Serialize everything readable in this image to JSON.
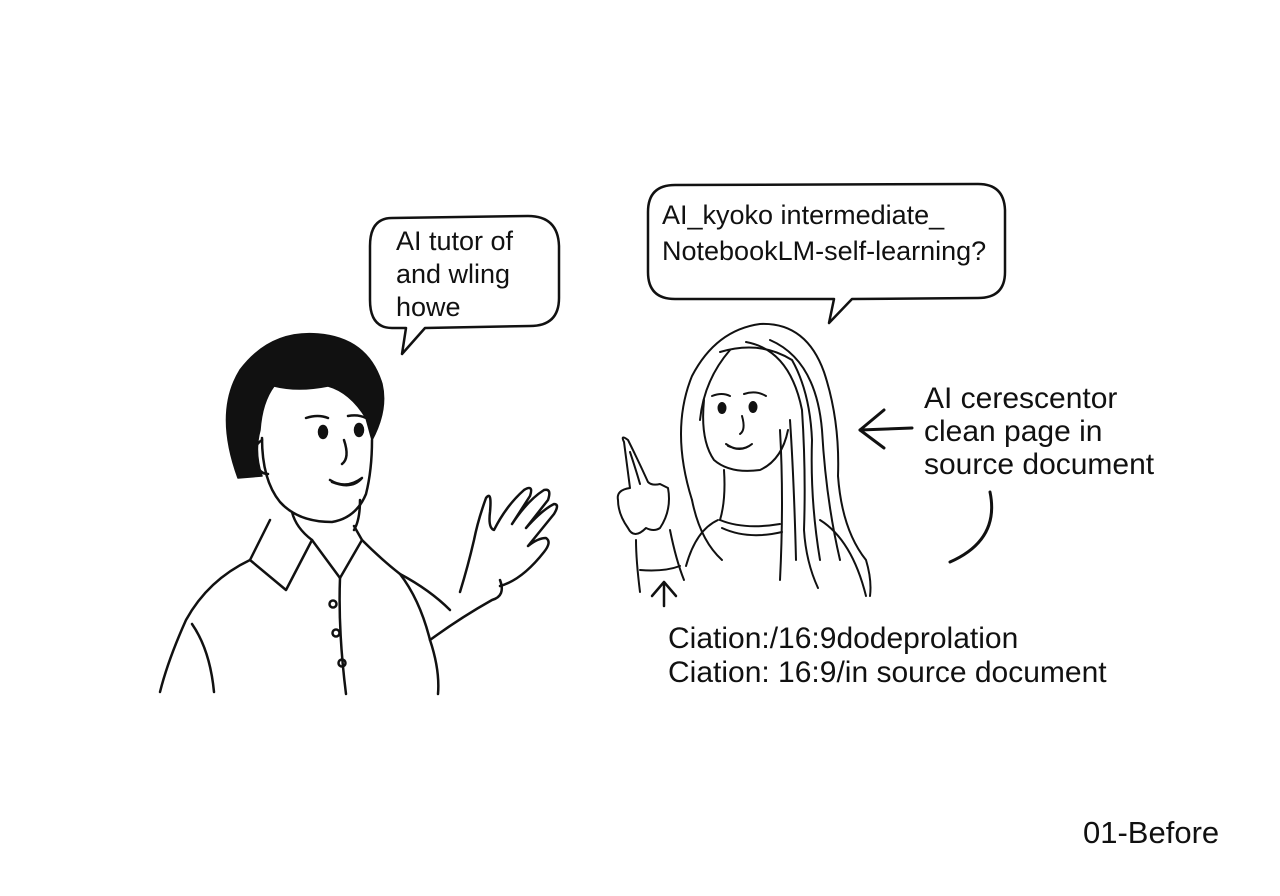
{
  "left_bubble": {
    "lines": [
      "AI tutor of",
      "and wling",
      "howe"
    ]
  },
  "right_bubble": {
    "lines": [
      "AI_kyoko intermediate_",
      "NotebookLM-self-learning?"
    ]
  },
  "annotation": {
    "lines": [
      "AI cerescentor",
      "clean page in",
      "source document"
    ]
  },
  "citations": {
    "lines": [
      "Ciation:/16:9dodeprolation",
      "Ciation: 16:9/in source document"
    ]
  },
  "caption": "01-Before",
  "colors": {
    "ink": "#111111",
    "background": "#ffffff"
  }
}
